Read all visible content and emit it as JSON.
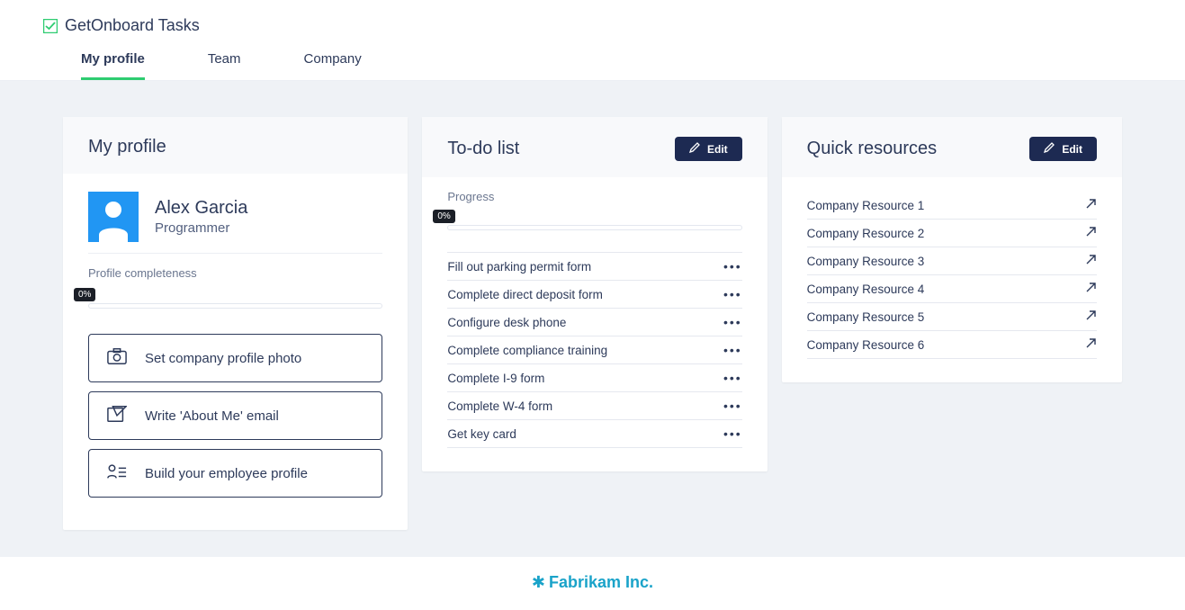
{
  "brand": {
    "text": "GetOnboard Tasks"
  },
  "tabs": [
    {
      "label": "My profile",
      "active": true
    },
    {
      "label": "Team",
      "active": false
    },
    {
      "label": "Company",
      "active": false
    }
  ],
  "profile": {
    "title": "My profile",
    "name": "Alex Garcia",
    "role": "Programmer",
    "completeness_label": "Profile completeness",
    "completeness_pct": "0%",
    "actions": [
      {
        "label": "Set company profile photo"
      },
      {
        "label": "Write 'About Me' email"
      },
      {
        "label": "Build your employee profile"
      }
    ]
  },
  "todo": {
    "title": "To-do list",
    "edit_label": "Edit",
    "progress_label": "Progress",
    "progress_pct": "0%",
    "items": [
      "Fill out parking permit form",
      "Complete direct deposit form",
      "Configure desk phone",
      "Complete compliance training",
      "Complete I-9 form",
      "Complete W-4 form",
      "Get key card"
    ]
  },
  "resources": {
    "title": "Quick resources",
    "edit_label": "Edit",
    "items": [
      "Company Resource 1",
      "Company Resource 2",
      "Company Resource 3",
      "Company Resource 4",
      "Company Resource 5",
      "Company Resource 6"
    ]
  },
  "footer": {
    "company": "Fabrikam Inc."
  }
}
